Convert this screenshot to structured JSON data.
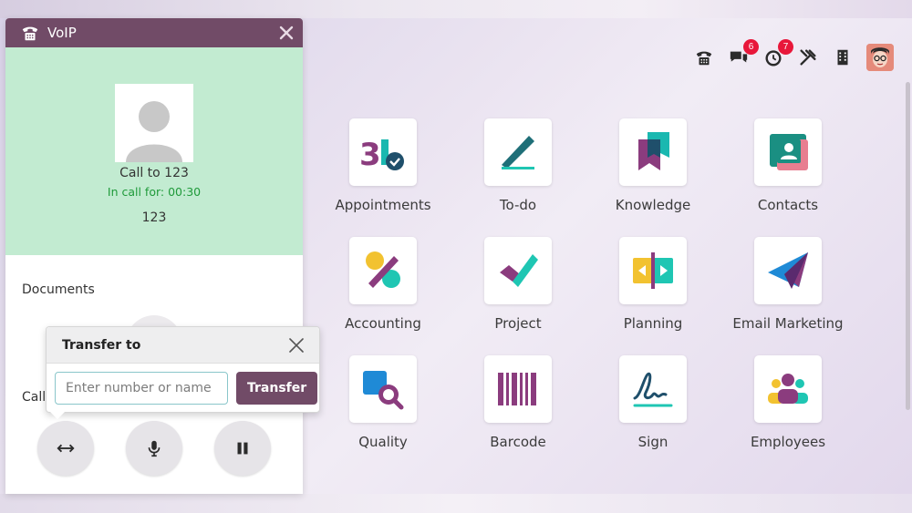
{
  "voip": {
    "title": "VoIP",
    "call_to": "Call to 123",
    "in_call_for": "In call for: 00:30",
    "number": "123",
    "documents_label": "Documents",
    "call_label": "Call"
  },
  "transfer": {
    "title": "Transfer to",
    "placeholder": "Enter number or name",
    "button_label": "Transfer"
  },
  "systray": {
    "messages_count": "6",
    "activities_count": "7"
  },
  "apps": [
    {
      "label": "Appointments"
    },
    {
      "label": "To-do"
    },
    {
      "label": "Knowledge"
    },
    {
      "label": "Contacts"
    },
    {
      "label": "Accounting"
    },
    {
      "label": "Project"
    },
    {
      "label": "Planning"
    },
    {
      "label": "Email Marketing"
    },
    {
      "label": "Quality"
    },
    {
      "label": "Barcode"
    },
    {
      "label": "Sign"
    },
    {
      "label": "Employees"
    }
  ],
  "colors": {
    "brand": "#714b67",
    "call_bg": "#c2ebd1",
    "timer_green": "#1f9a3a",
    "badge_red": "#e8173a"
  },
  "icons": [
    "phone-icon",
    "chat-icon",
    "clock-icon",
    "tools-icon",
    "building-icon",
    "close-icon",
    "transfer-arrows-icon",
    "microphone-icon",
    "pause-icon"
  ]
}
